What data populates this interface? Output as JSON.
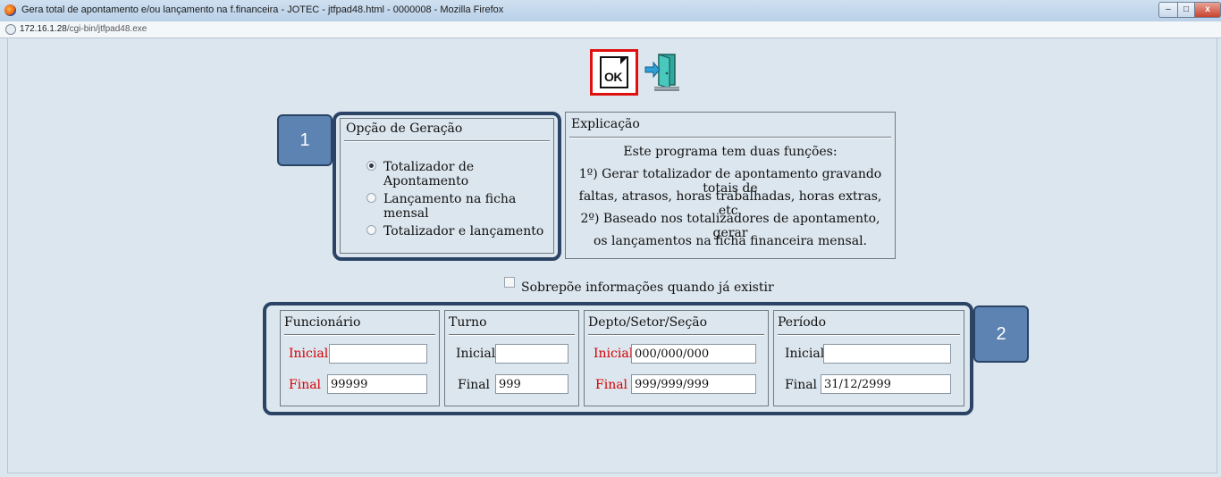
{
  "window": {
    "title": "Gera total de apontamento e/ou lançamento na f.financeira - JOTEC - jtfpad48.html - 0000008 - Mozilla Firefox",
    "url_host": "172.16.1.28",
    "url_path": "/cgi-bin/jtfpad48.exe",
    "controls": {
      "minimize": "–",
      "maximize": "□",
      "close": "x"
    }
  },
  "toolbar": {
    "ok_label": "OK",
    "ok_icon": "ok-document-icon",
    "exit_icon": "exit-door-icon"
  },
  "options": {
    "title": "Opção de Geração",
    "items": [
      {
        "label": "Totalizador de Apontamento",
        "selected": true
      },
      {
        "label": "Lançamento na ficha mensal",
        "selected": false
      },
      {
        "label": "Totalizador e lançamento",
        "selected": false
      }
    ]
  },
  "explanation": {
    "title": "Explicação",
    "lines": [
      "Este programa tem duas funções:",
      "1º) Gerar totalizador de apontamento gravando totais de",
      "faltas, atrasos, horas trabalhadas, horas extras, etc.",
      "2º) Baseado nos totalizadores de apontamento, gerar",
      "os lançamentos na ficha financeira mensal."
    ]
  },
  "overwrite": {
    "label": "Sobrepõe informações quando já existir",
    "checked": false
  },
  "ranges": {
    "funcionario": {
      "title": "Funcionário",
      "initial_label": "Inicial",
      "final_label": "Final",
      "initial_value": "",
      "final_value": "99999"
    },
    "turno": {
      "title": "Turno",
      "initial_label": "Inicial",
      "final_label": "Final",
      "initial_value": "",
      "final_value": "999"
    },
    "depto": {
      "title": "Depto/Setor/Seção",
      "initial_label": "Inicial",
      "final_label": "Final",
      "initial_value": "000/000/000",
      "final_value": "999/999/999"
    },
    "periodo": {
      "title": "Período",
      "initial_label": "Inicial",
      "final_label": "Final",
      "initial_value": "",
      "final_value": "31/12/2999"
    }
  },
  "callouts": {
    "one": "1",
    "two": "2"
  },
  "colors": {
    "required_label": "#d40000",
    "callout_border": "#2b4466",
    "callout_badge": "#5c83b1",
    "ok_highlight": "#e01010"
  }
}
